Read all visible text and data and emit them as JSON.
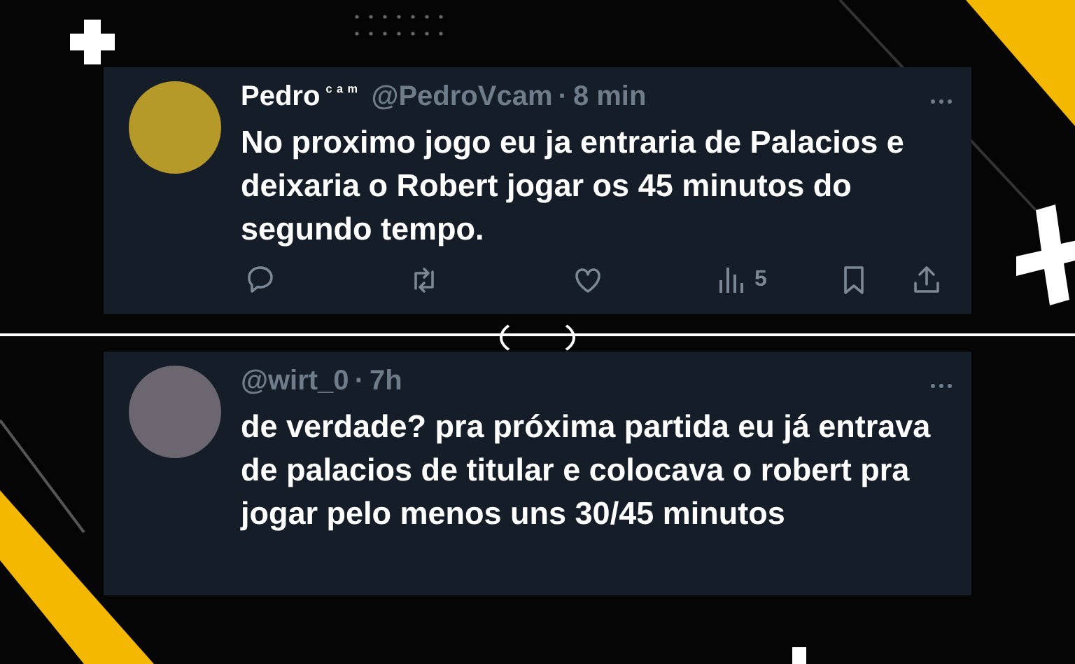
{
  "posts": [
    {
      "name": "Pedro",
      "name_suffix": "ᶜ ᵃ ᵐ",
      "handle": "@PedroVcam",
      "separator": "·",
      "time": "8 min",
      "text": "No proximo jogo eu ja entraria de Palacios e deixaria o Robert jogar os 45 minutos do segundo tempo.",
      "views": "5",
      "kind": "full"
    },
    {
      "handle": "@wirt_0",
      "separator": "·",
      "time": "7h",
      "text": "de verdade? pra próxima partida eu já entrava de palacios de titular e colocava o robert pra jogar pelo menos uns 30/45 minutos",
      "kind": "cropped"
    }
  ]
}
